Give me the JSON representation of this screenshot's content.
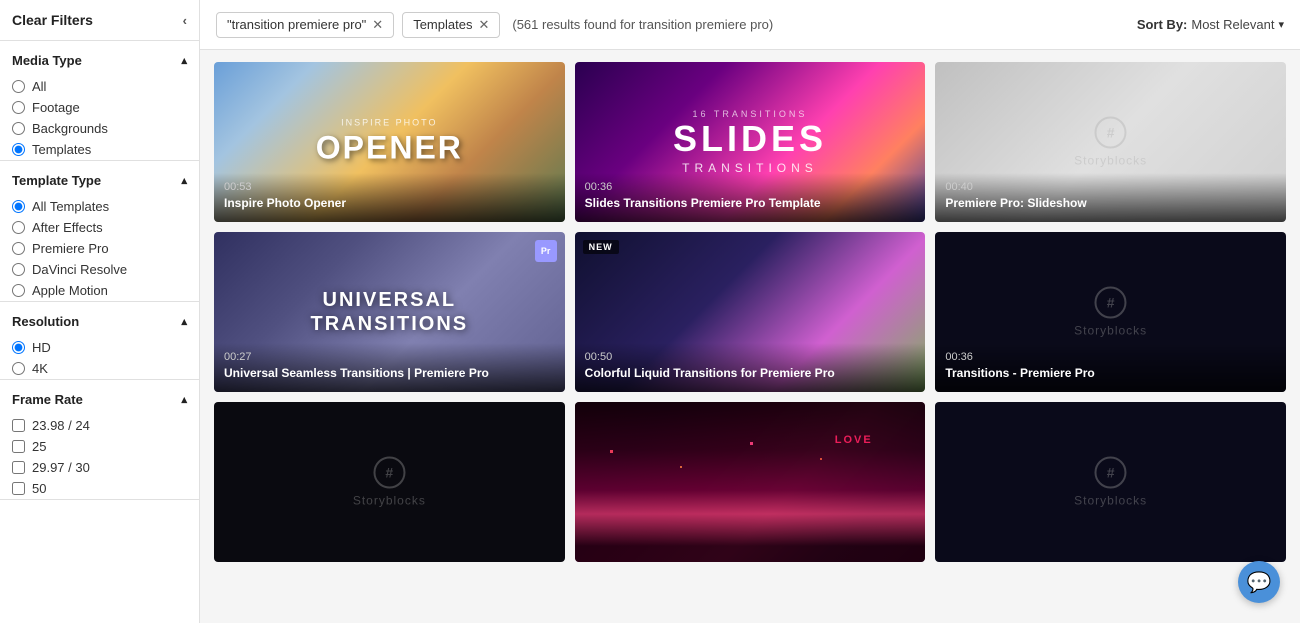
{
  "sidebar": {
    "clear_filters_label": "Clear Filters",
    "collapse_icon": "‹",
    "media_type_section": {
      "label": "Media Type",
      "options": [
        {
          "id": "all",
          "label": "All",
          "type": "radio",
          "checked": false
        },
        {
          "id": "footage",
          "label": "Footage",
          "type": "radio",
          "checked": false
        },
        {
          "id": "backgrounds",
          "label": "Backgrounds",
          "type": "radio",
          "checked": false
        },
        {
          "id": "templates",
          "label": "Templates",
          "type": "radio",
          "checked": true
        }
      ]
    },
    "template_type_section": {
      "label": "Template Type",
      "options": [
        {
          "id": "all-templates",
          "label": "All Templates",
          "type": "radio",
          "checked": true
        },
        {
          "id": "after-effects",
          "label": "After Effects",
          "type": "radio",
          "checked": false
        },
        {
          "id": "premiere-pro",
          "label": "Premiere Pro",
          "type": "radio",
          "checked": false
        },
        {
          "id": "davinci-resolve",
          "label": "DaVinci Resolve",
          "type": "radio",
          "checked": false
        },
        {
          "id": "apple-motion",
          "label": "Apple Motion",
          "type": "radio",
          "checked": false
        }
      ]
    },
    "resolution_section": {
      "label": "Resolution",
      "options": [
        {
          "id": "hd",
          "label": "HD",
          "type": "radio",
          "checked": true
        },
        {
          "id": "4k",
          "label": "4K",
          "type": "radio",
          "checked": false
        }
      ]
    },
    "frame_rate_section": {
      "label": "Frame Rate",
      "options": [
        {
          "id": "23-98",
          "label": "23.98 / 24",
          "type": "checkbox",
          "checked": false
        },
        {
          "id": "25",
          "label": "25",
          "type": "checkbox",
          "checked": false
        },
        {
          "id": "29-97",
          "label": "29.97 / 30",
          "type": "checkbox",
          "checked": false
        },
        {
          "id": "50",
          "label": "50",
          "type": "checkbox",
          "checked": false
        }
      ]
    }
  },
  "topbar": {
    "tags": [
      {
        "id": "query-tag",
        "label": "\"transition premiere pro\""
      },
      {
        "id": "templates-tag",
        "label": "Templates"
      }
    ],
    "results_count": "(561 results found for transition premiere pro)",
    "sort_by_label": "Sort By:",
    "sort_by_value": "Most Relevant",
    "sort_chevron": "▾"
  },
  "grid": {
    "cards": [
      {
        "id": "card-1",
        "type": "scenic",
        "bg_class": "card-bg-1",
        "time": "00:53",
        "title": "Inspire Photo Opener",
        "center_type": "inspire",
        "center_main": "OPENER",
        "center_sub": "Inspire Photo"
      },
      {
        "id": "card-2",
        "type": "purple",
        "bg_class": "card-bg-2",
        "time": "00:36",
        "title": "Slides Transitions Premiere Pro Template",
        "center_type": "slides",
        "center_main": "SLIDES",
        "center_sub": "TRANSITIONS",
        "center_sub2": "16 TRANSITIONS"
      },
      {
        "id": "card-3",
        "type": "storyblocks",
        "bg_class": "card-bg-3",
        "time": "00:40",
        "title": "Premiere Pro: Slideshow",
        "center_type": "storyblocks"
      },
      {
        "id": "card-4",
        "type": "universal",
        "bg_class": "card-bg-4",
        "time": "00:27",
        "title": "Universal Seamless Transitions | Premiere Pro",
        "center_type": "universal",
        "center_main": "UNIVERSAL\nTRANSITIONS",
        "badge_pr": true
      },
      {
        "id": "card-5",
        "type": "colorful",
        "bg_class": "card-bg-5",
        "time": "00:50",
        "title": "Colorful Liquid Transitions for Premiere Pro",
        "center_type": "none",
        "badge_new": true
      },
      {
        "id": "card-6",
        "type": "storyblocks",
        "bg_class": "card-bg-6",
        "time": "00:36",
        "title": "Transitions - Premiere Pro",
        "center_type": "storyblocks"
      },
      {
        "id": "card-7",
        "type": "storyblocks",
        "bg_class": "card-bg-7",
        "time": "",
        "title": "",
        "center_type": "storyblocks"
      },
      {
        "id": "card-8",
        "type": "city",
        "bg_class": "card-bg-8",
        "time": "",
        "title": "",
        "center_type": "none"
      },
      {
        "id": "card-9",
        "type": "storyblocks",
        "bg_class": "card-bg-9",
        "time": "",
        "title": "",
        "center_type": "storyblocks"
      }
    ]
  },
  "icons": {
    "chevron_left": "‹",
    "chevron_down": "▾",
    "chevron_up": "▴",
    "close_x": "✕",
    "chat": "💬"
  },
  "storyblocks": {
    "icon_char": "#",
    "text": "Storyblocks"
  }
}
